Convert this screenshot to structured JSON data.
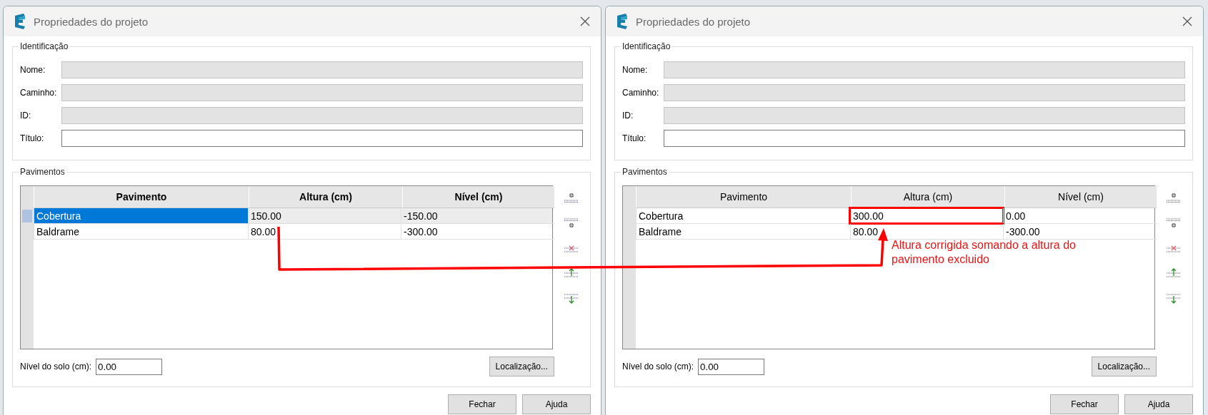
{
  "dialogs": [
    {
      "title": "Propriedades do projeto",
      "identification": {
        "legend": "Identificação",
        "fields": [
          {
            "label": "Nome:",
            "disabled": true
          },
          {
            "label": "Caminho:",
            "disabled": true
          },
          {
            "label": "ID:",
            "disabled": true
          },
          {
            "label": "Título:",
            "disabled": false
          }
        ]
      },
      "floors": {
        "legend": "Pavimentos",
        "header_bold": true,
        "columns": [
          "Pavimento",
          "Altura (cm)",
          "Nível (cm)"
        ],
        "rows": [
          {
            "selected": true,
            "cells": [
              {
                "text": "Cobertura",
                "highlighted": false
              },
              {
                "text": "150.00",
                "highlighted": false
              },
              {
                "text": "-150.00",
                "highlighted": false
              }
            ]
          },
          {
            "selected": false,
            "cells": [
              {
                "text": "Baldrame",
                "highlighted": false
              },
              {
                "text": "80.00",
                "highlighted": false
              },
              {
                "text": "-300.00",
                "highlighted": false
              }
            ]
          }
        ],
        "ground_level": {
          "label": "Nível do solo (cm):",
          "value": "0.00"
        },
        "location_button": "Localização..."
      },
      "buttons": [
        "Fechar",
        "Ajuda"
      ]
    },
    {
      "title": "Propriedades do projeto",
      "identification": {
        "legend": "Identificação",
        "fields": [
          {
            "label": "Nome:",
            "disabled": true
          },
          {
            "label": "Caminho:",
            "disabled": true
          },
          {
            "label": "ID:",
            "disabled": true
          },
          {
            "label": "Título:",
            "disabled": false
          }
        ]
      },
      "floors": {
        "legend": "Pavimentos",
        "header_bold": false,
        "columns": [
          "Pavimento",
          "Altura (cm)",
          "Nível (cm)"
        ],
        "rows": [
          {
            "selected": false,
            "cells": [
              {
                "text": "Cobertura",
                "highlighted": false
              },
              {
                "text": "300.00",
                "highlighted": true
              },
              {
                "text": "0.00",
                "highlighted": false
              }
            ]
          },
          {
            "selected": false,
            "cells": [
              {
                "text": "Baldrame",
                "highlighted": false
              },
              {
                "text": "80.00",
                "highlighted": false
              },
              {
                "text": "-300.00",
                "highlighted": false
              }
            ]
          }
        ],
        "ground_level": {
          "label": "Nível do solo (cm):",
          "value": "0.00"
        },
        "location_button": "Localização..."
      },
      "buttons": [
        "Fechar",
        "Ajuda"
      ]
    }
  ],
  "annotation": {
    "text": "Altura corrigida somando a altura do pavimento excluido"
  }
}
